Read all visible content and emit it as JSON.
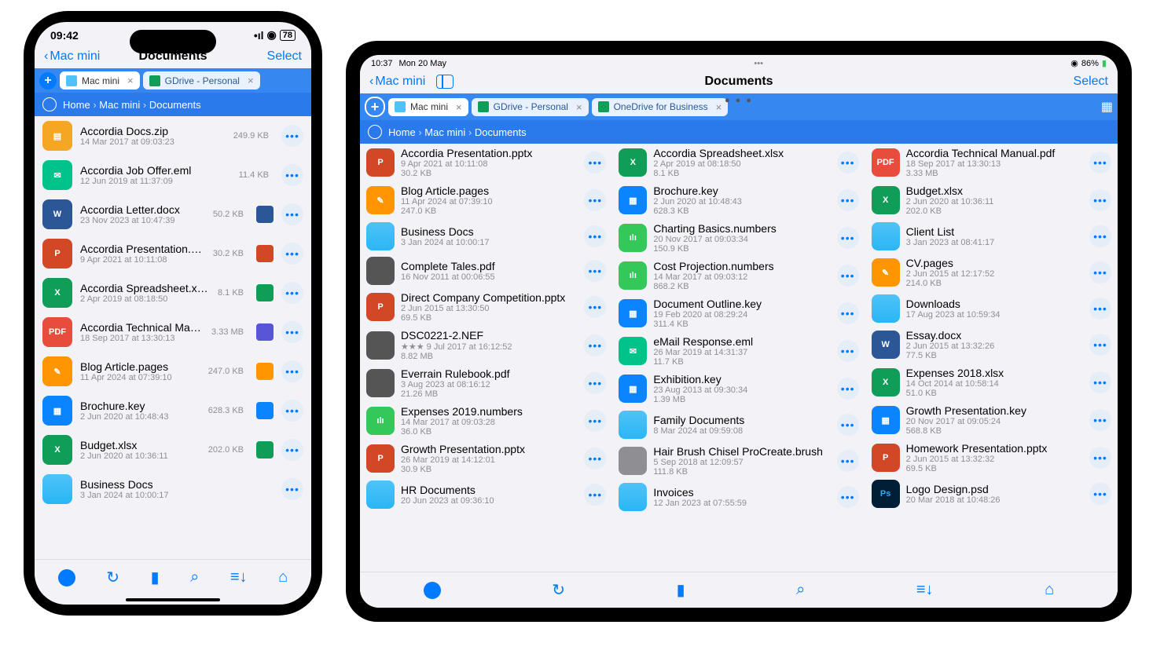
{
  "phone": {
    "status": {
      "time": "09:42",
      "battery": "78"
    },
    "nav": {
      "back": "Mac mini",
      "title": "Documents",
      "select": "Select"
    },
    "tabs": [
      {
        "label": "Mac mini",
        "active": true
      },
      {
        "label": "GDrive - Personal",
        "active": false
      }
    ],
    "breadcrumb": [
      "Home",
      "Mac mini",
      "Documents"
    ],
    "files": [
      {
        "name": "Accordia Docs.zip",
        "date": "14 Mar 2017 at 09:03:23",
        "size": "249.9 KB",
        "type": "zip"
      },
      {
        "name": "Accordia Job Offer.eml",
        "date": "12 Jun 2019 at 11:37:09",
        "size": "11.4 KB",
        "type": "eml"
      },
      {
        "name": "Accordia Letter.docx",
        "date": "23 Nov 2023 at 10:47:39",
        "size": "50.2 KB",
        "type": "docx",
        "badge": "#2b5797"
      },
      {
        "name": "Accordia Presentation.pptx",
        "date": "9 Apr 2021 at 10:11:08",
        "size": "30.2 KB",
        "type": "pptx",
        "badge": "#d24726"
      },
      {
        "name": "Accordia Spreadsheet.xlsx",
        "date": "2 Apr 2019 at 08:18:50",
        "size": "8.1 KB",
        "type": "xlsx",
        "badge": "#0f9d58"
      },
      {
        "name": "Accordia Technical Manual.pdf",
        "date": "18 Sep 2017 at 13:30:13",
        "size": "3.33 MB",
        "type": "pdf",
        "badge": "#5856d6"
      },
      {
        "name": "Blog Article.pages",
        "date": "11 Apr 2024 at 07:39:10",
        "size": "247.0 KB",
        "type": "pages",
        "badge": "#ff9500"
      },
      {
        "name": "Brochure.key",
        "date": "2 Jun 2020 at 10:48:43",
        "size": "628.3 KB",
        "type": "key",
        "badge": "#0a84ff"
      },
      {
        "name": "Budget.xlsx",
        "date": "2 Jun 2020 at 10:36:11",
        "size": "202.0 KB",
        "type": "xlsx",
        "badge": "#0f9d58"
      },
      {
        "name": "Business Docs",
        "date": "3 Jan 2024 at 10:00:17",
        "size": "",
        "type": "folder"
      }
    ]
  },
  "tablet": {
    "status": {
      "time": "10:37",
      "date": "Mon 20 May",
      "battery": "86%"
    },
    "nav": {
      "back": "Mac mini",
      "title": "Documents",
      "select": "Select"
    },
    "tabs": [
      {
        "label": "Mac mini",
        "active": true
      },
      {
        "label": "GDrive - Personal",
        "active": false
      },
      {
        "label": "OneDrive for Business",
        "active": false
      }
    ],
    "breadcrumb": [
      "Home",
      "Mac mini",
      "Documents"
    ],
    "columns": [
      [
        {
          "name": "Accordia Presentation.pptx",
          "date": "9 Apr 2021 at 10:11:08",
          "size": "30.2 KB",
          "type": "pptx"
        },
        {
          "name": "Blog Article.pages",
          "date": "11 Apr 2024 at 07:39:10",
          "size": "247.0 KB",
          "type": "pages"
        },
        {
          "name": "Business Docs",
          "date": "3 Jan 2024 at 10:00:17",
          "size": "",
          "type": "folder"
        },
        {
          "name": "Complete Tales.pdf",
          "date": "16 Nov 2011 at 00:06:55",
          "size": "",
          "type": "img"
        },
        {
          "name": "Direct Company Competition.pptx",
          "date": "2 Jun 2015 at 13:30:50",
          "size": "69.5 KB",
          "type": "pptx"
        },
        {
          "name": "DSC0221-2.NEF",
          "date": "★★★ 9 Jul 2017 at 16:12:52",
          "size": "8.82 MB",
          "type": "img"
        },
        {
          "name": "Everrain Rulebook.pdf",
          "date": "3 Aug 2023 at 08:16:12",
          "size": "21.26 MB",
          "type": "img"
        },
        {
          "name": "Expenses 2019.numbers",
          "date": "14 Mar 2017 at 09:03:28",
          "size": "36.0 KB",
          "type": "numbers"
        },
        {
          "name": "Growth Presentation.pptx",
          "date": "26 Mar 2019 at 14:12:01",
          "size": "30.9 KB",
          "type": "pptx"
        },
        {
          "name": "HR Documents",
          "date": "20 Jun 2023 at 09:36:10",
          "size": "",
          "type": "folder"
        }
      ],
      [
        {
          "name": "Accordia Spreadsheet.xlsx",
          "date": "2 Apr 2019 at 08:18:50",
          "size": "8.1 KB",
          "type": "xlsx"
        },
        {
          "name": "Brochure.key",
          "date": "2 Jun 2020 at 10:48:43",
          "size": "628.3 KB",
          "type": "key"
        },
        {
          "name": "Charting Basics.numbers",
          "date": "20 Nov 2017 at 09:03:34",
          "size": "150.9 KB",
          "type": "numbers"
        },
        {
          "name": "Cost Projection.numbers",
          "date": "14 Mar 2017 at 09:03:12",
          "size": "868.2 KB",
          "type": "numbers"
        },
        {
          "name": "Document Outline.key",
          "date": "19 Feb 2020 at 08:29:24",
          "size": "311.4 KB",
          "type": "key"
        },
        {
          "name": "eMail Response.eml",
          "date": "26 Mar 2019 at 14:31:37",
          "size": "11.7 KB",
          "type": "eml"
        },
        {
          "name": "Exhibition.key",
          "date": "23 Aug 2013 at 09:30:34",
          "size": "1.39 MB",
          "type": "key"
        },
        {
          "name": "Family Documents",
          "date": "8 Mar 2024 at 09:59:08",
          "size": "",
          "type": "folder"
        },
        {
          "name": "Hair Brush Chisel ProCreate.brush",
          "date": "5 Sep 2018 at 12:09:57",
          "size": "111.8 KB",
          "type": "generic"
        },
        {
          "name": "Invoices",
          "date": "12 Jan 2023 at 07:55:59",
          "size": "",
          "type": "folder"
        }
      ],
      [
        {
          "name": "Accordia Technical Manual.pdf",
          "date": "18 Sep 2017 at 13:30:13",
          "size": "3.33 MB",
          "type": "pdf"
        },
        {
          "name": "Budget.xlsx",
          "date": "2 Jun 2020 at 10:36:11",
          "size": "202.0 KB",
          "type": "xlsx"
        },
        {
          "name": "Client List",
          "date": "3 Jan 2023 at 08:41:17",
          "size": "",
          "type": "folder"
        },
        {
          "name": "CV.pages",
          "date": "2 Jun 2015 at 12:17:52",
          "size": "214.0 KB",
          "type": "pages"
        },
        {
          "name": "Downloads",
          "date": "17 Aug 2023 at 10:59:34",
          "size": "",
          "type": "folder"
        },
        {
          "name": "Essay.docx",
          "date": "2 Jun 2015 at 13:32:26",
          "size": "77.5 KB",
          "type": "docx"
        },
        {
          "name": "Expenses 2018.xlsx",
          "date": "14 Oct 2014 at 10:58:14",
          "size": "51.0 KB",
          "type": "xlsx"
        },
        {
          "name": "Growth Presentation.key",
          "date": "20 Nov 2017 at 09:05:24",
          "size": "568.8 KB",
          "type": "key"
        },
        {
          "name": "Homework Presentation.pptx",
          "date": "2 Jun 2015 at 13:32:32",
          "size": "69.5 KB",
          "type": "pptx"
        },
        {
          "name": "Logo Design.psd",
          "date": "20 Mar 2018 at 10:48:26",
          "size": "",
          "type": "ps"
        }
      ]
    ]
  },
  "toolbar_icons": [
    "add",
    "refresh",
    "bookmark",
    "search",
    "sort",
    "home"
  ]
}
